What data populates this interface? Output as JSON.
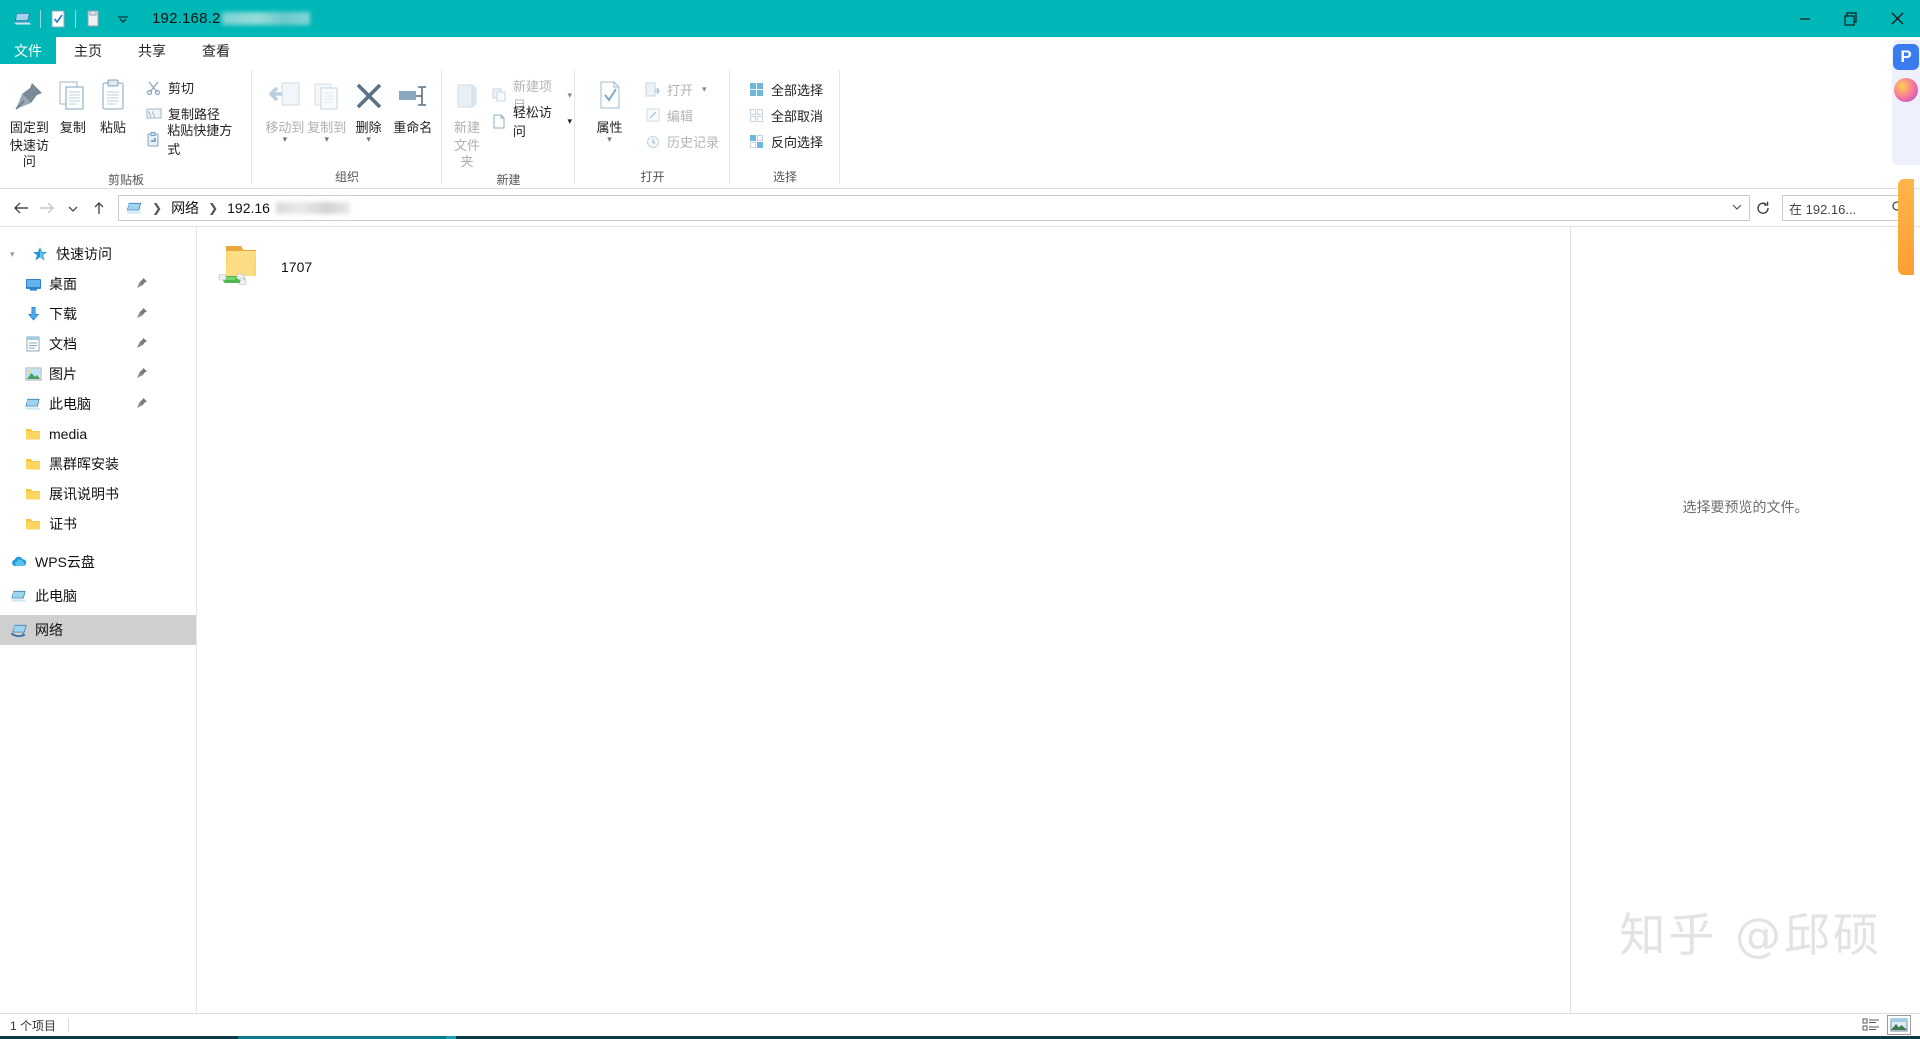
{
  "window": {
    "title": "192.168.2",
    "title_redacted_suffix": true,
    "accent_color": "#00b7b7",
    "quick_access_icons": [
      "this-pc-icon",
      "properties-checkbox-icon",
      "new-folder-icon",
      "customize-chevron-icon"
    ],
    "controls": {
      "minimize": "—",
      "maximize": "❐",
      "close": "✕"
    }
  },
  "tabs": {
    "file": "文件",
    "items": [
      {
        "label": "主页",
        "active": true
      },
      {
        "label": "共享",
        "active": false
      },
      {
        "label": "查看",
        "active": false
      }
    ],
    "collapse_icon": "chevron-up-icon"
  },
  "ribbon": {
    "groups": [
      {
        "name": "clipboard",
        "label": "剪贴板",
        "big": [
          {
            "label": "固定到\n快速访问",
            "label_line1": "固定到",
            "label_line2": "快速访问",
            "icon": "pin-icon",
            "enabled": true
          },
          {
            "label": "复制",
            "icon": "copy-icon",
            "enabled": true
          },
          {
            "label": "粘贴",
            "icon": "paste-icon",
            "enabled": true
          }
        ],
        "small": [
          {
            "label": "剪切",
            "icon": "scissors-icon",
            "enabled": true
          },
          {
            "label": "复制路径",
            "icon": "copy-path-icon",
            "enabled": true
          },
          {
            "label": "粘贴快捷方式",
            "icon": "paste-shortcut-icon",
            "enabled": true
          }
        ]
      },
      {
        "name": "organize",
        "label": "组织",
        "big": [
          {
            "label": "移动到",
            "icon": "move-to-icon",
            "enabled": false,
            "has_caret": true
          },
          {
            "label": "复制到",
            "icon": "copy-to-icon",
            "enabled": false,
            "has_caret": true
          },
          {
            "label": "删除",
            "icon": "delete-x-icon",
            "enabled": true,
            "has_caret": true
          },
          {
            "label": "重命名",
            "icon": "rename-icon",
            "enabled": true
          }
        ],
        "small": []
      },
      {
        "name": "new",
        "label": "新建",
        "big": [
          {
            "label_line1": "新建",
            "label_line2": "文件夹",
            "icon": "new-folder-icon",
            "enabled": false
          }
        ],
        "small": [
          {
            "label": "新建项目",
            "icon": "new-item-icon",
            "enabled": false,
            "has_caret": true
          },
          {
            "label": "轻松访问",
            "icon": "easy-access-icon",
            "enabled": true,
            "has_caret": true
          }
        ]
      },
      {
        "name": "open",
        "label": "打开",
        "big": [
          {
            "label": "属性",
            "icon": "properties-icon",
            "enabled": true,
            "has_caret": true
          }
        ],
        "small": [
          {
            "label": "打开",
            "icon": "open-icon",
            "enabled": false,
            "has_caret": true
          },
          {
            "label": "编辑",
            "icon": "edit-icon",
            "enabled": false
          },
          {
            "label": "历史记录",
            "icon": "history-icon",
            "enabled": false
          }
        ]
      },
      {
        "name": "select",
        "label": "选择",
        "big": [],
        "small": [
          {
            "label": "全部选择",
            "icon": "select-all-icon",
            "enabled": true
          },
          {
            "label": "全部取消",
            "icon": "select-none-icon",
            "enabled": true
          },
          {
            "label": "反向选择",
            "icon": "invert-selection-icon",
            "enabled": true
          }
        ]
      }
    ]
  },
  "address_bar": {
    "back_icon": "arrow-left-icon",
    "forward_icon": "arrow-right-icon",
    "recent_icon": "chevron-down-icon",
    "up_icon": "arrow-up-icon",
    "root_icon": "network-computer-icon",
    "crumbs": [
      "网络",
      "192.16"
    ],
    "crumb_redacted": true,
    "dropdown_icon": "chevron-down-icon",
    "refresh_icon": "refresh-icon"
  },
  "search": {
    "placeholder": "在 192.16...",
    "icon": "search-icon"
  },
  "sidebar": {
    "items": [
      {
        "label": "快速访问",
        "icon": "star-icon",
        "level": 0,
        "twisty": true,
        "pinned": false,
        "selected": false
      },
      {
        "label": "桌面",
        "icon": "desktop-icon",
        "level": 1,
        "pinned": true,
        "selected": false
      },
      {
        "label": "下载",
        "icon": "download-icon",
        "level": 1,
        "pinned": true,
        "selected": false
      },
      {
        "label": "文档",
        "icon": "documents-icon",
        "level": 1,
        "pinned": true,
        "selected": false
      },
      {
        "label": "图片",
        "icon": "pictures-icon",
        "level": 1,
        "pinned": true,
        "selected": false
      },
      {
        "label": "此电脑",
        "icon": "this-pc-icon",
        "level": 1,
        "pinned": true,
        "selected": false
      },
      {
        "label": "media",
        "icon": "folder-icon",
        "level": 1,
        "pinned": false,
        "selected": false
      },
      {
        "label": "黑群晖安装",
        "icon": "folder-icon",
        "level": 1,
        "pinned": false,
        "selected": false
      },
      {
        "label": "展讯说明书",
        "icon": "folder-icon",
        "level": 1,
        "pinned": false,
        "selected": false
      },
      {
        "label": "证书",
        "icon": "folder-icon",
        "level": 1,
        "pinned": false,
        "selected": false
      },
      {
        "label": "WPS云盘",
        "icon": "cloud-icon",
        "level": 0,
        "pinned": false,
        "selected": false
      },
      {
        "label": "此电脑",
        "icon": "this-pc-icon",
        "level": 0,
        "pinned": false,
        "selected": false
      },
      {
        "label": "网络",
        "icon": "network-icon",
        "level": 0,
        "pinned": false,
        "selected": true
      }
    ]
  },
  "files": {
    "items": [
      {
        "name": "1707",
        "icon": "shared-folder-icon",
        "selected": false
      }
    ]
  },
  "preview": {
    "message": "选择要预览的文件。"
  },
  "status_bar": {
    "item_count": "1 个项目",
    "view_buttons": [
      {
        "icon": "details-view-icon",
        "selected": false
      },
      {
        "icon": "large-icons-view-icon",
        "selected": true
      }
    ]
  },
  "watermark": {
    "text": "知乎 @邱硕"
  }
}
